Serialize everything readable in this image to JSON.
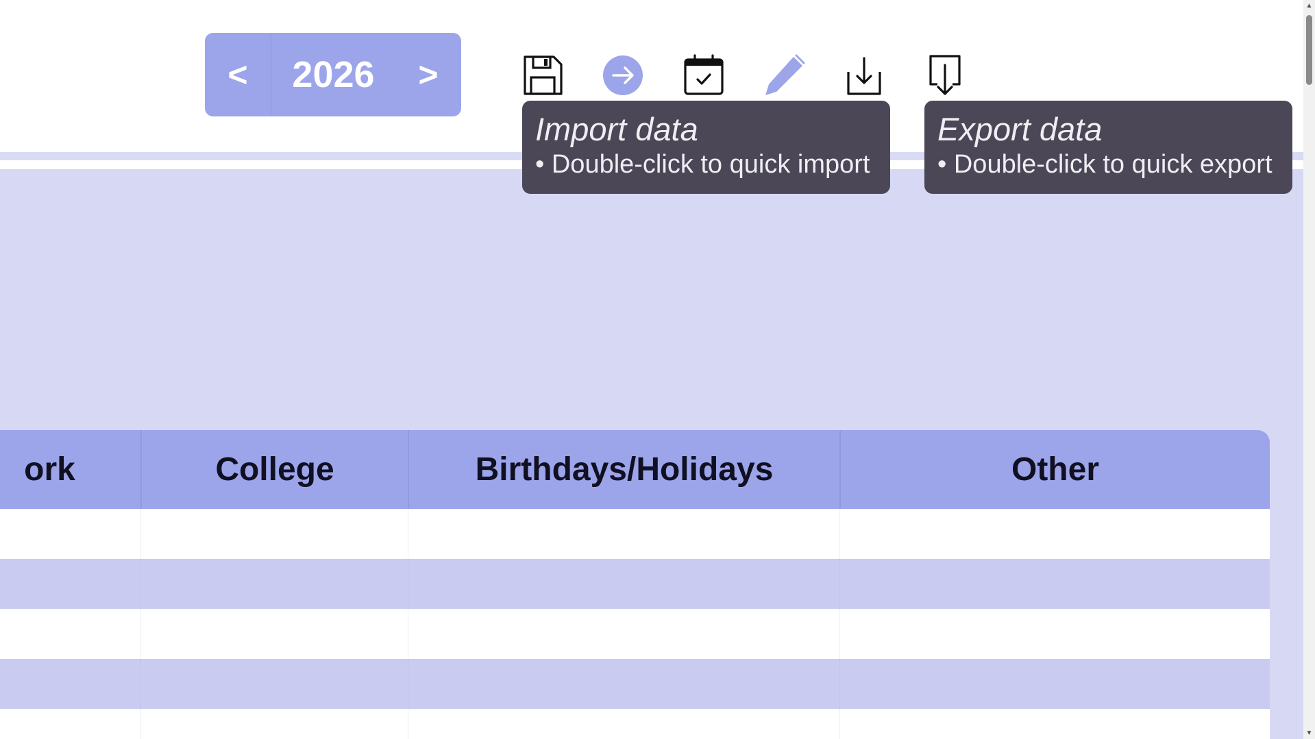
{
  "year_nav": {
    "prev_label": "<",
    "year": "2026",
    "next_label": ">"
  },
  "toolbar": {
    "icons": [
      "save-icon",
      "arrow-right-circle-icon",
      "calendar-check-icon",
      "pen-icon",
      "import-icon",
      "export-icon"
    ],
    "accent_color": "#9ca5ea"
  },
  "tooltips": {
    "import": {
      "title": "Import data",
      "hint": "• Double-click to quick import"
    },
    "export": {
      "title": "Export data",
      "hint": "• Double-click to quick export"
    }
  },
  "table": {
    "columns": [
      "ork",
      "College",
      "Birthdays/Holidays",
      "Other"
    ],
    "header_color": "#9ca5ea",
    "row_tint_color": "#c9cbf1"
  },
  "colors": {
    "page_background": "#d7d9f4",
    "tooltip_background": "#4b4756"
  }
}
